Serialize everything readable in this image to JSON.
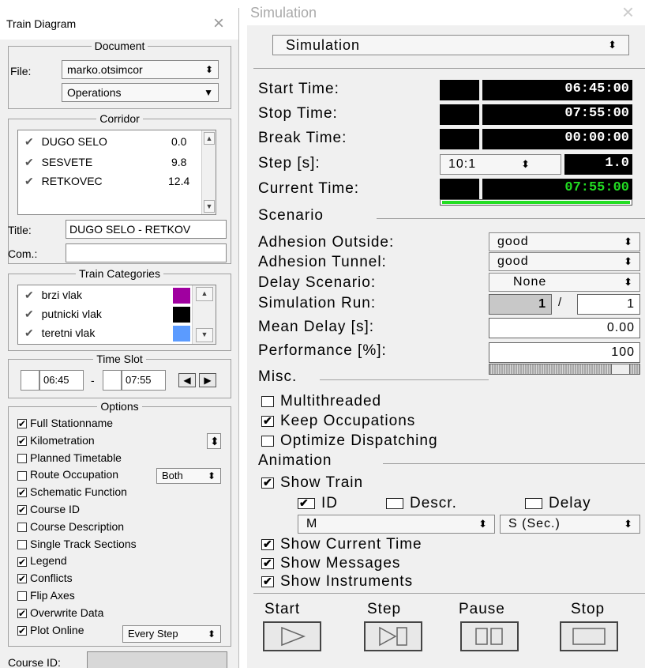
{
  "left": {
    "title": "Train Diagram",
    "document": {
      "legend": "Document",
      "file_label": "File:",
      "file_value": "marko.otsimcor",
      "operations": "Operations"
    },
    "corridor": {
      "legend": "Corridor",
      "stations": [
        {
          "name": "DUGO SELO",
          "km": "0.0"
        },
        {
          "name": "SESVETE",
          "km": "9.8"
        },
        {
          "name": "RETKOVEC",
          "km": "12.4"
        }
      ],
      "title_label": "Title:",
      "title_value": "DUGO SELO - RETKOV",
      "com_label": "Com.:",
      "com_value": ""
    },
    "categories": {
      "legend": "Train Categories",
      "items": [
        {
          "name": "brzi vlak",
          "color": "#a000a0"
        },
        {
          "name": "putnicki vlak",
          "color": "#000000"
        },
        {
          "name": "teretni vlak",
          "color": "#5b9bff"
        }
      ]
    },
    "timeslot": {
      "legend": "Time Slot",
      "from": "06:45",
      "sep": "-",
      "to": "07:55"
    },
    "options": {
      "legend": "Options",
      "items": [
        {
          "label": "Full Stationname",
          "checked": true
        },
        {
          "label": "Kilometration",
          "checked": true
        },
        {
          "label": "Planned Timetable",
          "checked": false
        },
        {
          "label": "Route Occupation",
          "checked": false
        },
        {
          "label": "Schematic Function",
          "checked": true
        },
        {
          "label": "Course ID",
          "checked": true
        },
        {
          "label": "Course Description",
          "checked": false
        },
        {
          "label": "Single Track Sections",
          "checked": false
        },
        {
          "label": "Legend",
          "checked": true
        },
        {
          "label": "Conflicts",
          "checked": true
        },
        {
          "label": "Flip Axes",
          "checked": false
        },
        {
          "label": "Overwrite Data",
          "checked": true
        },
        {
          "label": "Plot Online",
          "checked": true
        }
      ],
      "route_occupation_value": "Both",
      "plot_online_value": "Every Step"
    },
    "course_id_label": "Course ID:"
  },
  "right": {
    "title": "Simulation",
    "mode": "Simulation",
    "times": {
      "start_label": "Start Time:",
      "start_value": "06:45:00",
      "stop_label": "Stop Time:",
      "stop_value": "07:55:00",
      "break_label": "Break Time:",
      "break_value": "00:00:00",
      "step_label": "Step [s]:",
      "step_ratio": "10:1",
      "step_value": "1.0",
      "current_label": "Current Time:",
      "current_value": "07:55:00",
      "current_color": "#22dd22",
      "progress": 1.0
    },
    "scenario": {
      "legend": "Scenario",
      "adh_out_label": "Adhesion Outside:",
      "adh_out_value": "good",
      "adh_tun_label": "Adhesion Tunnel:",
      "adh_tun_value": "good",
      "delay_label": "Delay Scenario:",
      "delay_value": "None",
      "run_label": "Simulation Run:",
      "run_current": "1",
      "run_sep": "/",
      "run_total": "1",
      "mean_label": "Mean Delay [s]:",
      "mean_value": "0.00",
      "perf_label": "Performance [%]:",
      "perf_value": "100"
    },
    "misc": {
      "legend": "Misc.",
      "multithreaded": "Multithreaded",
      "keep": "Keep Occupations",
      "optimize": "Optimize Dispatching"
    },
    "animation": {
      "legend": "Animation",
      "show_train": "Show Train",
      "id": "ID",
      "descr": "Descr.",
      "delay": "Delay",
      "sel1": "M",
      "sel2": "S (Sec.)",
      "show_time": "Show Current Time",
      "show_messages": "Show Messages",
      "show_instruments": "Show Instruments"
    },
    "controls": {
      "start": "Start",
      "step": "Step",
      "pause": "Pause",
      "stop": "Stop"
    }
  }
}
